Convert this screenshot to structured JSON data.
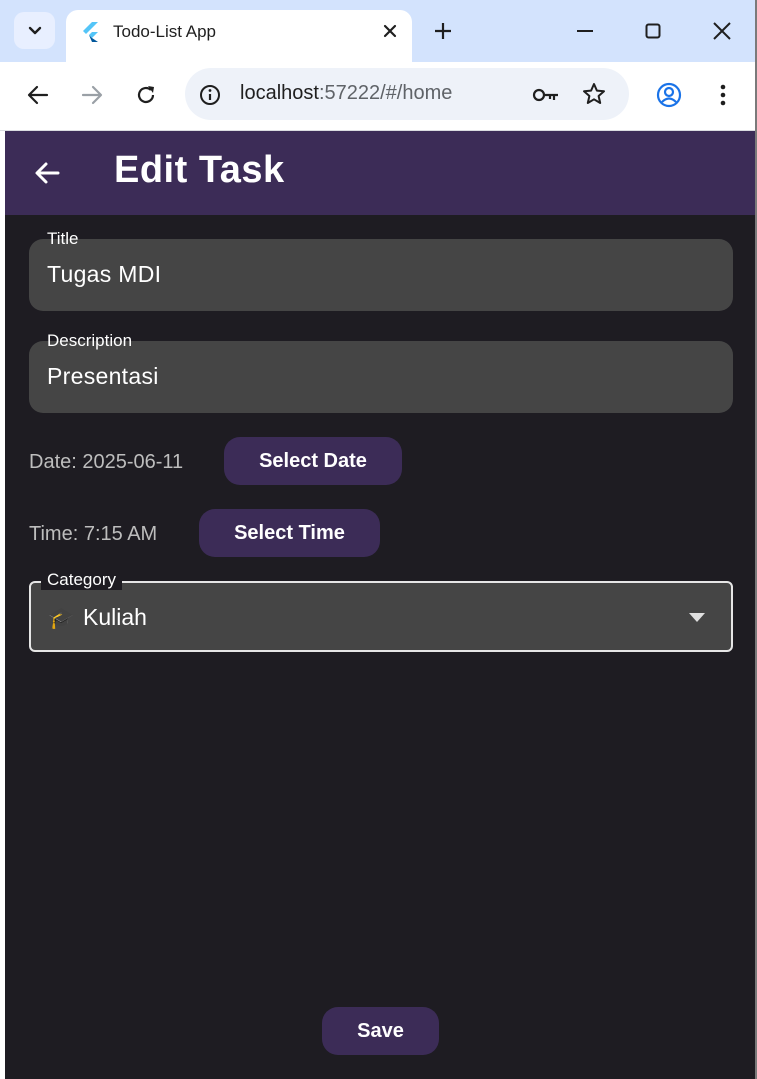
{
  "browser": {
    "tab_title": "Todo-List App",
    "url_host": "localhost",
    "url_rest": ":57222/#/home",
    "icons": [
      "chevron-down-icon",
      "flutter-logo-icon",
      "close-icon",
      "plus-icon",
      "minimize-icon",
      "maximize-icon",
      "window-close-icon",
      "back-arrow-icon",
      "forward-arrow-icon",
      "reload-icon",
      "site-info-icon",
      "key-icon",
      "star-icon",
      "profile-icon",
      "more-vert-icon"
    ]
  },
  "app": {
    "title": "Edit Task",
    "colors": {
      "appbar": "#3c2c57",
      "background": "#1e1c22",
      "field": "#454545",
      "button": "#3c2c57"
    }
  },
  "form": {
    "title_label": "Title",
    "title_value": "Tugas MDI",
    "description_label": "Description",
    "description_value": "Presentasi",
    "date_text": "Date: 2025-06-11",
    "select_date_label": "Select Date",
    "time_text": "Time: 7:15 AM",
    "select_time_label": "Select Time",
    "category_label": "Category",
    "category_icon": "🎓",
    "category_value": "Kuliah",
    "save_label": "Save"
  }
}
